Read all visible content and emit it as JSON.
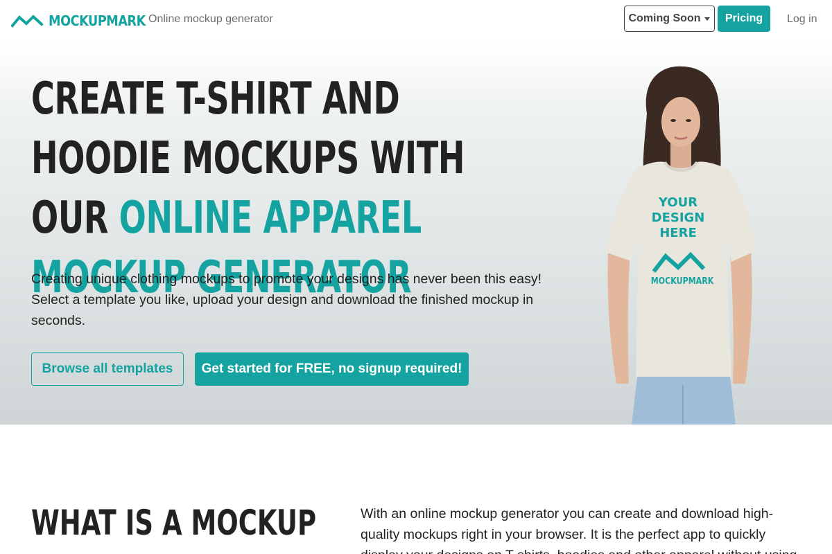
{
  "navbar": {
    "brand_name": "MOCKUPMARK",
    "tagline": "Online mockup generator",
    "coming_soon_label": "Coming Soon",
    "pricing_label": "Pricing",
    "login_label": "Log in"
  },
  "hero": {
    "headline_part1": "CREATE T-SHIRT AND HOODIE MOCKUPS WITH OUR ",
    "headline_accent": "ONLINE APPAREL MOCKUP GENERATOR",
    "lead": "Creating unique clothing mockups to promote your designs has never been this easy! Select a template you like, upload your design and download the finished mockup in seconds.",
    "browse_label": "Browse all templates",
    "start_label": "Get started for FREE, no signup required!",
    "shirt_line1": "YOUR",
    "shirt_line2": "DESIGN",
    "shirt_line3": "HERE",
    "shirt_brand": "MOCKUPMARK"
  },
  "section": {
    "title": "WHAT IS A MOCKUP",
    "body": "With an online mockup generator you can create and download high-quality mockups right in your browser. It is the perfect app to quickly display your designs on T-shirts, hoodies and other apparel without using"
  },
  "colors": {
    "accent": "#14a3a0",
    "text": "#222222"
  }
}
